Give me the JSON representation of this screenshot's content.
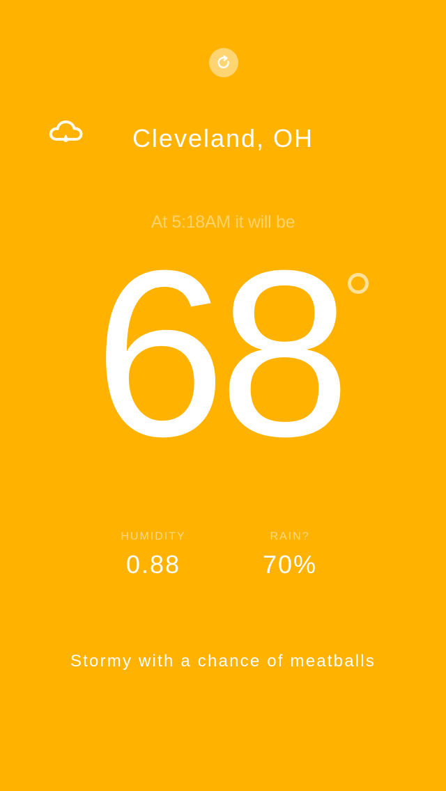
{
  "colors": {
    "background": "#FFB300",
    "text": "#FFFFFF"
  },
  "header": {
    "refresh_icon": "refresh-icon"
  },
  "weather": {
    "condition_icon": "cloud-rain-icon",
    "location": "Cleveland, OH",
    "forecast_time": "At 5:18AM it will be",
    "temperature": "68",
    "degree_icon": "degree-icon"
  },
  "stats": {
    "humidity": {
      "label": "HUMIDITY",
      "value": "0.88"
    },
    "rain": {
      "label": "RAIN?",
      "value": "70%"
    }
  },
  "summary": "Stormy with a chance of meatballs"
}
